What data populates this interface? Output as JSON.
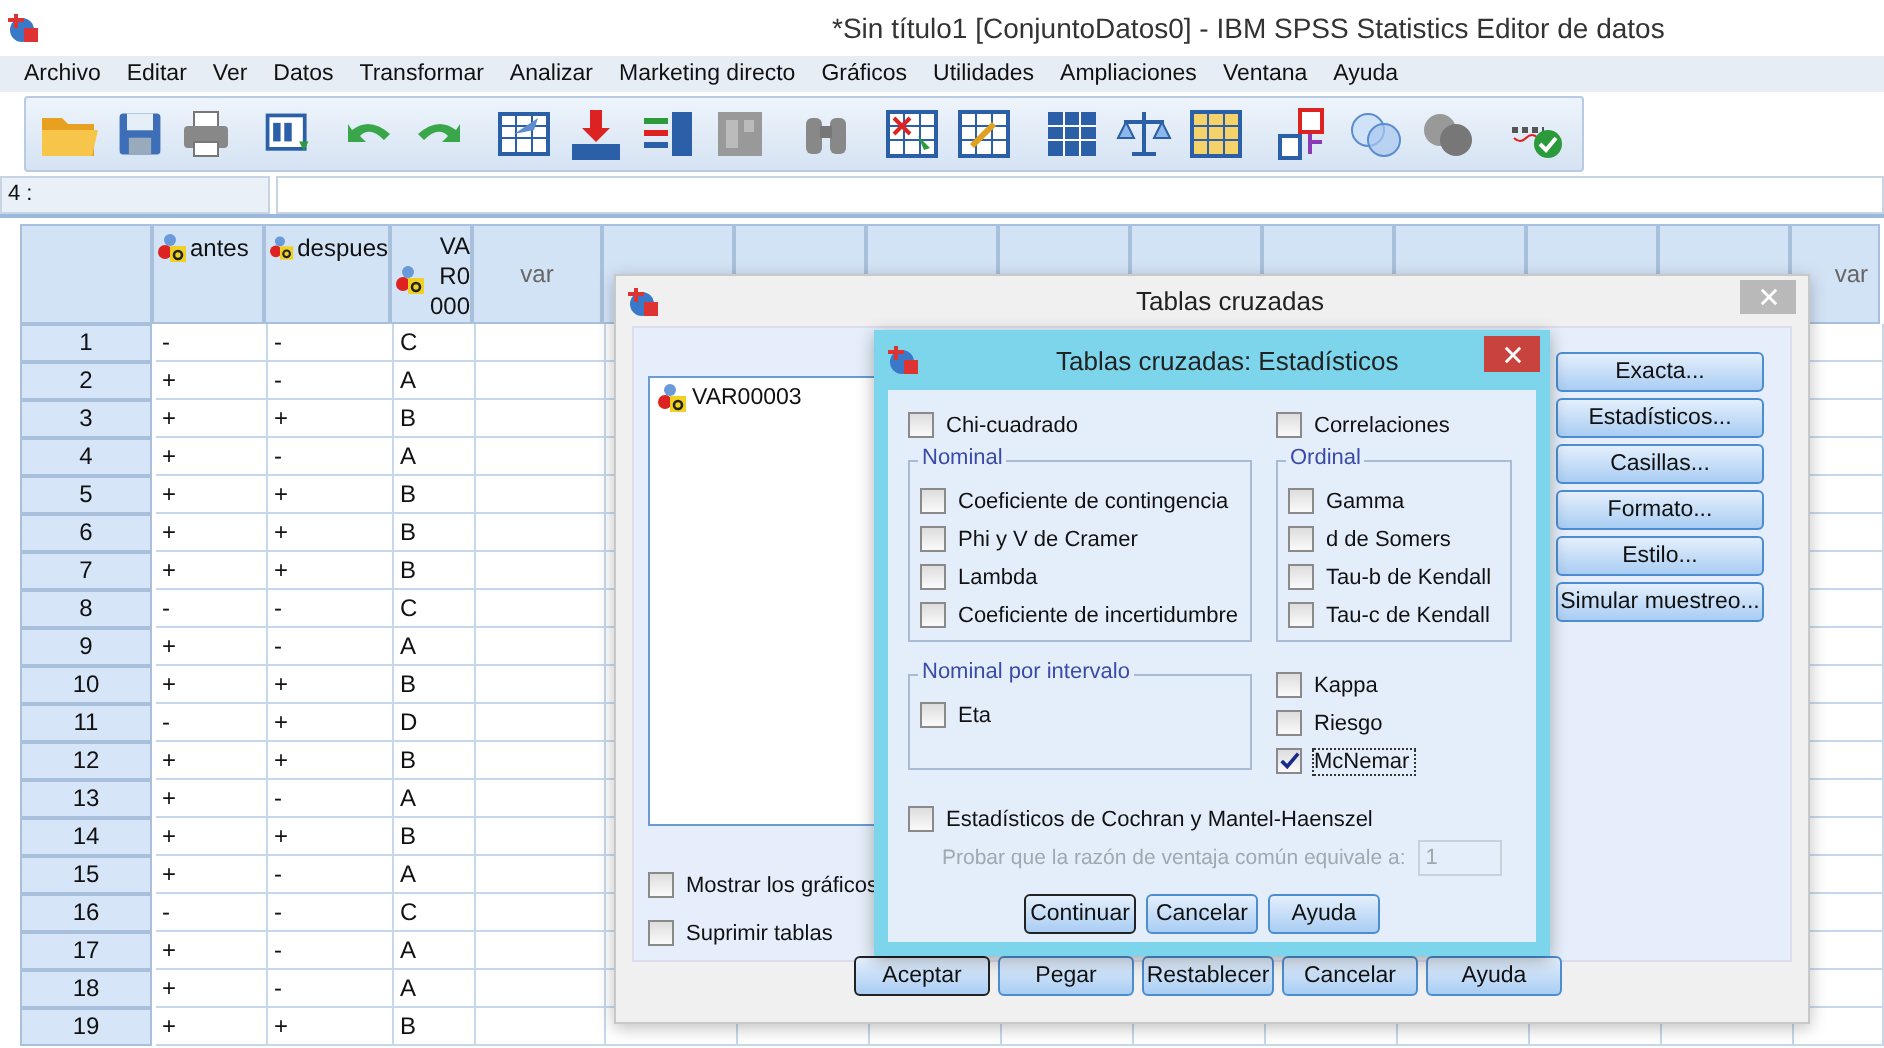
{
  "window": {
    "title": "*Sin título1 [ConjuntoDatos0] - IBM SPSS Statistics Editor de datos"
  },
  "menu": [
    "Archivo",
    "Editar",
    "Ver",
    "Datos",
    "Transformar",
    "Analizar",
    "Marketing directo",
    "Gráficos",
    "Utilidades",
    "Ampliaciones",
    "Ventana",
    "Ayuda"
  ],
  "cell_editor": {
    "cell": "4 :"
  },
  "grid": {
    "columns": [
      {
        "kind": "variable",
        "name": "antes"
      },
      {
        "kind": "variable",
        "name": "despues"
      },
      {
        "kind": "truncated",
        "lines": [
          "VA",
          "R0",
          "000"
        ]
      },
      {
        "kind": "empty",
        "label": "var"
      },
      {
        "kind": "covered"
      },
      {
        "kind": "covered"
      },
      {
        "kind": "covered"
      },
      {
        "kind": "covered"
      },
      {
        "kind": "covered"
      },
      {
        "kind": "covered"
      },
      {
        "kind": "covered"
      },
      {
        "kind": "covered"
      },
      {
        "kind": "covered"
      },
      {
        "kind": "empty",
        "label": "var"
      }
    ],
    "rows": [
      {
        "number": "1",
        "cells": [
          "-",
          "-",
          "C"
        ]
      },
      {
        "number": "2",
        "cells": [
          "+",
          "-",
          "A"
        ]
      },
      {
        "number": "3",
        "cells": [
          "+",
          "+",
          "B"
        ]
      },
      {
        "number": "4",
        "cells": [
          "+",
          "-",
          "A"
        ]
      },
      {
        "number": "5",
        "cells": [
          "+",
          "+",
          "B"
        ]
      },
      {
        "number": "6",
        "cells": [
          "+",
          "+",
          "B"
        ]
      },
      {
        "number": "7",
        "cells": [
          "+",
          "+",
          "B"
        ]
      },
      {
        "number": "8",
        "cells": [
          "-",
          "-",
          "C"
        ]
      },
      {
        "number": "9",
        "cells": [
          "+",
          "-",
          "A"
        ]
      },
      {
        "number": "10",
        "cells": [
          "+",
          "+",
          "B"
        ]
      },
      {
        "number": "11",
        "cells": [
          "-",
          "+",
          "D"
        ]
      },
      {
        "number": "12",
        "cells": [
          "+",
          "+",
          "B"
        ]
      },
      {
        "number": "13",
        "cells": [
          "+",
          "-",
          "A"
        ]
      },
      {
        "number": "14",
        "cells": [
          "+",
          "+",
          "B"
        ]
      },
      {
        "number": "15",
        "cells": [
          "+",
          "-",
          "A"
        ]
      },
      {
        "number": "16",
        "cells": [
          "-",
          "-",
          "C"
        ]
      },
      {
        "number": "17",
        "cells": [
          "+",
          "-",
          "A"
        ]
      },
      {
        "number": "18",
        "cells": [
          "+",
          "-",
          "A"
        ]
      },
      {
        "number": "19",
        "cells": [
          "+",
          "+",
          "B"
        ]
      }
    ]
  },
  "crosstabs_dialog": {
    "title": "Tablas cruzadas",
    "variables": [
      {
        "name": "VAR00003"
      }
    ],
    "options": [
      {
        "label": "Mostrar los gráficos",
        "checked": false
      },
      {
        "label": "Suprimir tablas",
        "checked": false
      }
    ],
    "side_buttons": [
      "Exacta...",
      "Estadísticos...",
      "Casillas...",
      "Formato...",
      "Estilo...",
      "Simular muestreo..."
    ],
    "buttons": [
      {
        "label": "Aceptar",
        "default": true
      },
      {
        "label": "Pegar",
        "default": false
      },
      {
        "label": "Restablecer",
        "default": false
      },
      {
        "label": "Cancelar",
        "default": false
      },
      {
        "label": "Ayuda",
        "default": false
      }
    ]
  },
  "statistics_dialog": {
    "title": "Tablas cruzadas: Estadísticos",
    "chi_square": {
      "label": "Chi-cuadrado",
      "checked": false
    },
    "correlations": {
      "label": "Correlaciones",
      "checked": false
    },
    "nominal": {
      "title": "Nominal",
      "items": [
        {
          "label": "Coeficiente de contingencia",
          "checked": false
        },
        {
          "label": "Phi y V de Cramer",
          "checked": false
        },
        {
          "label": "Lambda",
          "checked": false
        },
        {
          "label": "Coeficiente de incertidumbre",
          "checked": false
        }
      ]
    },
    "ordinal": {
      "title": "Ordinal",
      "items": [
        {
          "label": "Gamma",
          "checked": false
        },
        {
          "label": "d de Somers",
          "checked": false
        },
        {
          "label": "Tau-b de Kendall",
          "checked": false
        },
        {
          "label": "Tau-c de Kendall",
          "checked": false
        }
      ]
    },
    "nominal_interval": {
      "title": "Nominal por intervalo",
      "items": [
        {
          "label": "Eta",
          "checked": false
        }
      ]
    },
    "other": [
      {
        "label": "Kappa",
        "checked": false,
        "focused": false
      },
      {
        "label": "Riesgo",
        "checked": false,
        "focused": false
      },
      {
        "label": "McNemar",
        "checked": true,
        "focused": true
      }
    ],
    "cochran": {
      "label": "Estadísticos de Cochran y Mantel-Haenszel",
      "checked": false
    },
    "odds_ratio": {
      "label": "Probar que la razón de ventaja común equivale a:",
      "value": "1",
      "disabled": true
    },
    "buttons": [
      {
        "label": "Continuar",
        "default": true
      },
      {
        "label": "Cancelar",
        "default": false
      },
      {
        "label": "Ayuda",
        "default": false
      }
    ]
  }
}
